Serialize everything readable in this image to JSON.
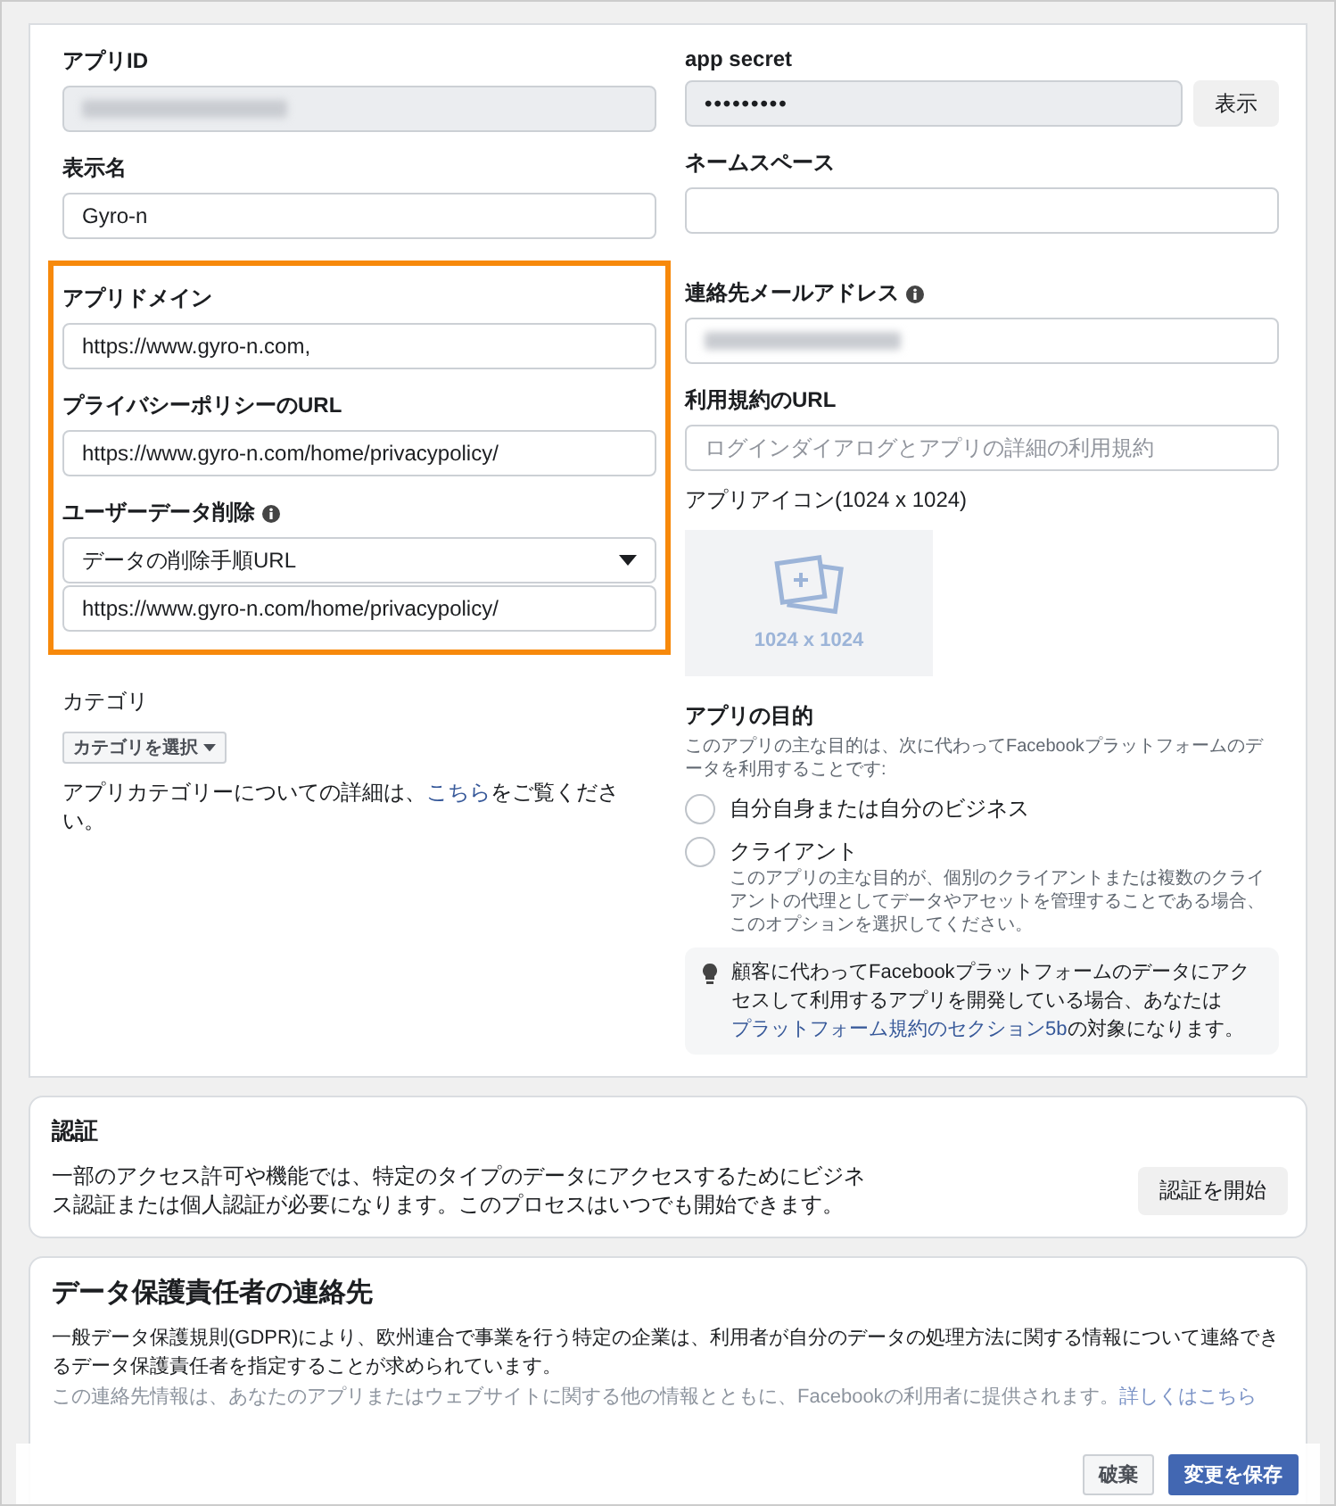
{
  "basic": {
    "app_id": {
      "label": "アプリID"
    },
    "app_secret": {
      "label": "app secret",
      "value": "•••••••••",
      "button": "表示"
    },
    "display_name": {
      "label": "表示名",
      "value": "Gyro-n"
    },
    "namespace": {
      "label": "ネームスペース"
    },
    "highlighted": {
      "app_domain": {
        "label": "アプリドメイン",
        "value": "https://www.gyro-n.com,"
      },
      "privacy_url": {
        "label": "プライバシーポリシーのURL",
        "value": "https://www.gyro-n.com/home/privacypolicy/"
      },
      "user_data_deletion": {
        "label": "ユーザーデータ削除",
        "select": "データの削除手順URL",
        "value": "https://www.gyro-n.com/home/privacypolicy/"
      }
    },
    "contact_email": {
      "label": "連絡先メールアドレス"
    },
    "terms_url": {
      "label": "利用規約のURL",
      "placeholder": "ログインダイアログとアプリの詳細の利用規約"
    },
    "app_icon": {
      "label": "アプリアイコン(1024 x 1024)",
      "size": "1024 x 1024"
    },
    "category": {
      "label": "カテゴリ",
      "button": "カテゴリを選択",
      "help_before": "アプリカテゴリーについての詳細は、",
      "help_link": "こちら",
      "help_after": "をご覧ください。"
    },
    "purpose": {
      "label": "アプリの目的",
      "description": "このアプリの主な目的は、次に代わってFacebookプラットフォームのデータを利用することです:",
      "options": [
        {
          "label": "自分自身または自分のビジネス",
          "selected": false
        },
        {
          "label": "クライアント",
          "selected": false,
          "description": "このアプリの主な目的が、個別のクライアントまたは複数のクライアントの代理としてデータやアセットを管理することである場合、このオプションを選択してください。"
        }
      ],
      "tip_before": "顧客に代わってFacebookプラットフォームのデータにアクセスして利用するアプリを開発している場合、あなたは",
      "tip_link": "プラットフォーム規約のセクション5b",
      "tip_after": "の対象になります。"
    }
  },
  "verification": {
    "title": "認証",
    "text": "一部のアクセス許可や機能では、特定のタイプのデータにアクセスするためにビジネス認証または個人認証が必要になります。このプロセスはいつでも開始できます。",
    "button": "認証を開始"
  },
  "dpo": {
    "title": "データ保護責任者の連絡先",
    "text": "一般データ保護規則(GDPR)により、欧州連合で事業を行う特定の企業は、利用者が自分のデータの処理方法に関する情報について連絡できるデータ保護責任者を指定することが求められています。",
    "note": "この連絡先情報は、あなたのアプリまたはウェブサイトに関する他の情報とともに、Facebookの利用者に提供されます。",
    "note_link": "詳しくはこちら"
  },
  "save_bar": {
    "discard": "破棄",
    "save": "変更を保存"
  }
}
